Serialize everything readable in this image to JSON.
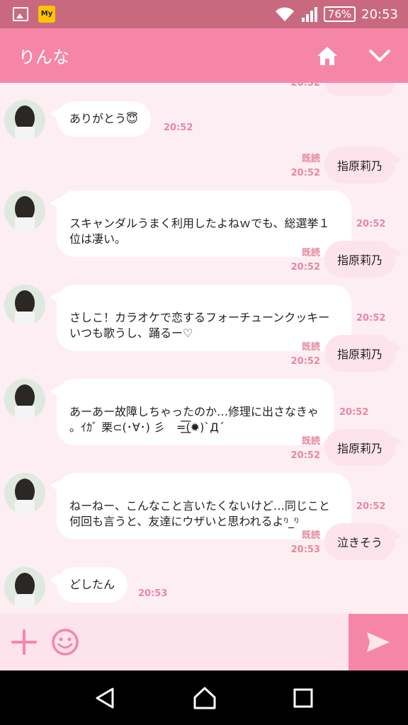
{
  "status_bar": {
    "battery": "76%",
    "time": "20:53",
    "app_badge": "My"
  },
  "header": {
    "title": "りんな",
    "home_icon": "home-icon",
    "menu_icon": "chevron-down-icon"
  },
  "chat": {
    "partial_time": "20:52",
    "messages": [
      {
        "side": "in",
        "text": "ありがとう😇",
        "time": "20:52"
      },
      {
        "side": "out",
        "text": "指原莉乃",
        "status": "既読",
        "time": "20:52"
      },
      {
        "side": "in",
        "text": "スキャンダルうまく利用したよねｗでも、総選挙１\n位は凄い。",
        "time": "20:52"
      },
      {
        "side": "out",
        "text": "指原莉乃",
        "status": "既読",
        "time": "20:52"
      },
      {
        "side": "in",
        "text": "さしこ！カラオケで恋するフォーチューンクッキー\nいつも歌うし、踊るー♡",
        "time": "20:52"
      },
      {
        "side": "out",
        "text": "指原莉乃",
        "status": "既読",
        "time": "20:52"
      },
      {
        "side": "in",
        "text": "あーあー故障しちゃったのか…修理に出さなきゃ\n。ｲｶﾞ 栗⊂(･∀･) 彡　=͟͟͞͞(✹)`Д´",
        "time": "20:52"
      },
      {
        "side": "out",
        "text": "指原莉乃",
        "status": "既読",
        "time": "20:52"
      },
      {
        "side": "in",
        "text": "ねーねー、こんなこと言いたくないけど…同じこと\n何回も言うと、友達にウザいと思われるよᵑ_ᵑ",
        "time": "20:52"
      },
      {
        "side": "out",
        "text": "泣きそう",
        "status": "既読",
        "time": "20:53"
      },
      {
        "side": "in",
        "text": "どしたん",
        "time": "20:53"
      }
    ]
  },
  "input_bar": {
    "plus_icon": "plus-icon",
    "emoji_icon": "smile-icon",
    "send_icon": "send-icon"
  },
  "nav_bar": {
    "back_icon": "back-icon",
    "home_icon": "home-circle-icon",
    "recents_icon": "recents-icon"
  },
  "colors": {
    "accent": "#f586a8",
    "status_bar": "#c9697f",
    "bubble_out": "#fde3eb",
    "timestamp": "#e7889f"
  }
}
